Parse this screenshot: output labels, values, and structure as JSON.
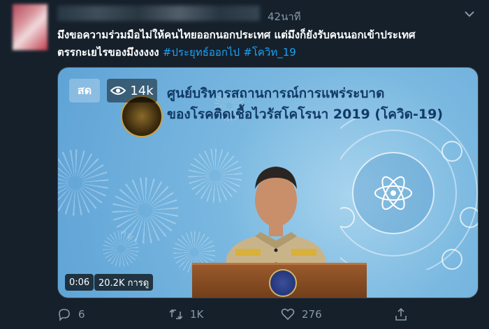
{
  "header": {
    "time_ago": "42นาที"
  },
  "tweet": {
    "text_line1": "มึงขอความร่วมมือไม่ให้คนไทยออกนอกประเทศ แต่มึงก็ยังรับคนนอกเข้าประเทศ",
    "text_line2_prefix": "ตรรกะเ",
    "text_line2_mid": "ยไรของมึงงงงง ",
    "hashtag1": "#ประยุทธ์ออกไป",
    "hashtag2": "#โควิท_19"
  },
  "media": {
    "live_label": "สด",
    "viewers": "14k",
    "headline_line1": "ศูนย์บริหารสถานการณ์การแพร่ระบาด",
    "headline_line2": "ของโรคติดเชื้อไวรัสโคโรนา 2019 (โควิด-19)",
    "elapsed": "0:06",
    "plays": "20.2K การดู"
  },
  "actions": {
    "replies": "6",
    "retweets": "1K",
    "likes": "276"
  },
  "colors": {
    "background": "#15202b",
    "link": "#1da1f2",
    "muted": "#8899a6"
  }
}
